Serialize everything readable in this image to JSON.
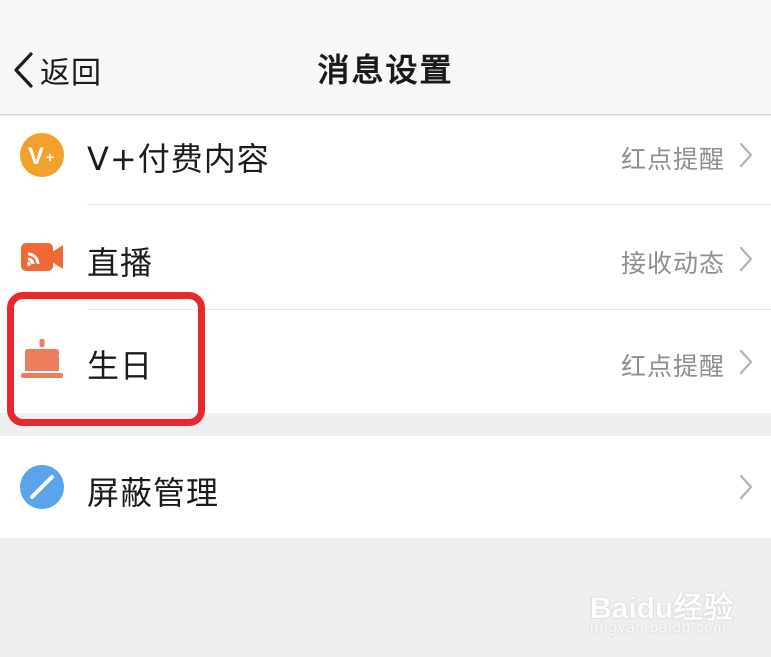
{
  "nav": {
    "back_label": "返回",
    "title": "消息设置"
  },
  "settings": [
    {
      "label": "V+付费内容",
      "value": "红点提醒",
      "icon": "v-plus-icon",
      "icon_color": "#f2a12c"
    },
    {
      "label": "直播",
      "value": "接收动态",
      "icon": "live-broadcast-icon",
      "icon_color": "#ef6a35"
    },
    {
      "label": "生日",
      "value": "红点提醒",
      "icon": "birthday-cake-icon",
      "icon_color": "#ee7d5e"
    }
  ],
  "blocking": {
    "label": "屏蔽管理",
    "value": "",
    "icon": "block-icon",
    "icon_color": "#5aa4ea"
  },
  "highlight_color": "#e8282d",
  "watermark": {
    "brand": "Baidu经验",
    "sub": "jingyan.baidu.com"
  }
}
